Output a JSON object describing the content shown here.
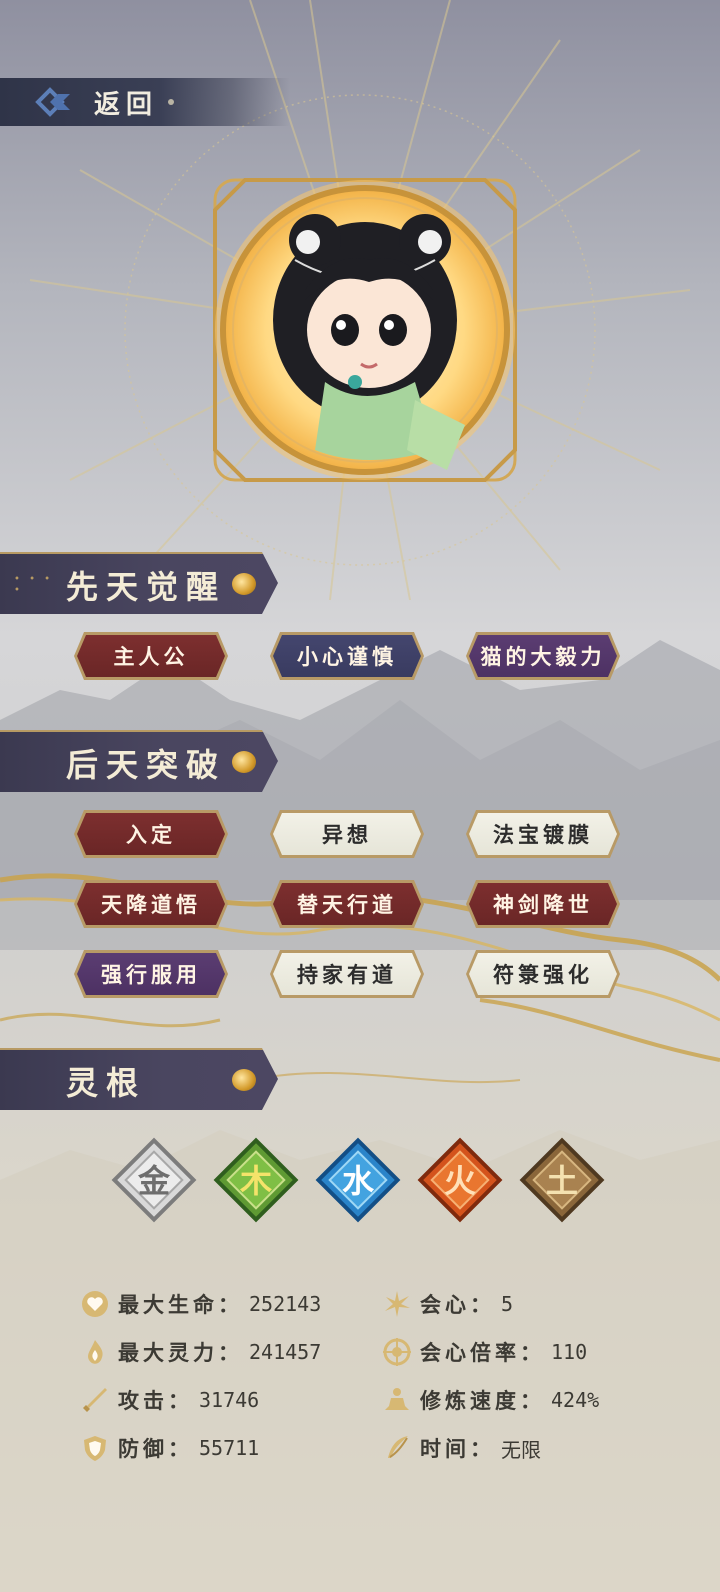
{
  "back": {
    "label": "返回"
  },
  "sections": {
    "innate": {
      "title": "先天觉醒"
    },
    "acquired": {
      "title": "后天突破"
    },
    "roots": {
      "title": "灵根"
    }
  },
  "innate_traits": [
    {
      "label": "主人公",
      "style": "red"
    },
    {
      "label": "小心谨慎",
      "style": "blue"
    },
    {
      "label": "猫的大毅力",
      "style": "purple"
    }
  ],
  "acquired_traits": [
    {
      "label": "入定",
      "style": "red"
    },
    {
      "label": "异想",
      "style": "white"
    },
    {
      "label": "法宝镀膜",
      "style": "white"
    },
    {
      "label": "天降道悟",
      "style": "red"
    },
    {
      "label": "替天行道",
      "style": "red"
    },
    {
      "label": "神剑降世",
      "style": "red"
    },
    {
      "label": "强行服用",
      "style": "purple"
    },
    {
      "label": "持家有道",
      "style": "white"
    },
    {
      "label": "符箓强化",
      "style": "white"
    }
  ],
  "elements": [
    {
      "char": "金",
      "color": "#c9c9c9"
    },
    {
      "char": "木",
      "color": "#6aa63a"
    },
    {
      "char": "水",
      "color": "#2f8fd0"
    },
    {
      "char": "火",
      "color": "#d9561e"
    },
    {
      "char": "土",
      "color": "#8c6a3c"
    }
  ],
  "stats": {
    "max_hp": {
      "label": "最大生命：",
      "value": "252143",
      "icon": "heart-icon"
    },
    "max_mana": {
      "label": "最大灵力：",
      "value": "241457",
      "icon": "flame-icon"
    },
    "attack": {
      "label": "攻击：",
      "value": "31746",
      "icon": "sword-icon"
    },
    "defense": {
      "label": "防御：",
      "value": "55711",
      "icon": "shield-icon"
    },
    "crit": {
      "label": "会心：",
      "value": "5",
      "icon": "burst-icon"
    },
    "crit_mult": {
      "label": "会心倍率：",
      "value": "110",
      "icon": "target-icon"
    },
    "cultivation_speed": {
      "label": "修炼速度：",
      "value": "424%",
      "icon": "meditation-icon"
    },
    "time": {
      "label": "时间：",
      "value": "无限",
      "icon": "feather-icon"
    }
  },
  "colors": {
    "gold": "#b79a63",
    "panel": "#3b3950"
  }
}
